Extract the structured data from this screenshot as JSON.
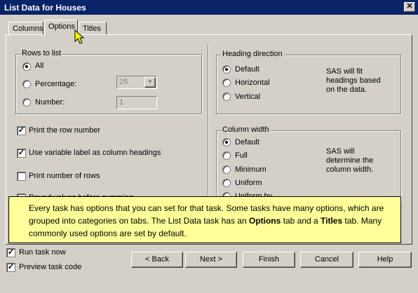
{
  "window": {
    "title": "List Data for Houses"
  },
  "tabs": [
    {
      "label": "Columns"
    },
    {
      "label": "Options"
    },
    {
      "label": "Titles"
    }
  ],
  "rows_to_list": {
    "legend": "Rows to list",
    "all_label": "All",
    "percentage_label": "Percentage:",
    "percentage_value": "25",
    "number_label": "Number:",
    "number_value": "1"
  },
  "checkboxes": [
    {
      "label": "Print the row number",
      "checked": true
    },
    {
      "label": "Use variable label as column headings",
      "checked": true
    },
    {
      "label": "Print number of rows",
      "checked": false
    },
    {
      "label": "Round values before summing",
      "checked": false
    }
  ],
  "heading_direction": {
    "legend": "Heading direction",
    "options": [
      "Default",
      "Horizontal",
      "Vertical"
    ],
    "selected": "Default",
    "note": "SAS will fit headings based on the data."
  },
  "column_width": {
    "legend": "Column width",
    "options": [
      "Default",
      "Full",
      "Minimum",
      "Uniform",
      "Uniform by"
    ],
    "selected": "Default",
    "note": "SAS will determine the column width."
  },
  "callout": {
    "text_1": "Every task has options that you can set for that task.  Some tasks have many options, which are grouped into categories on tabs.  The List Data task has an ",
    "bold_1": "Options",
    "text_2": " tab and a ",
    "bold_2": "Titles",
    "text_3": " tab.  Many commonly used options are set by default."
  },
  "footer": {
    "run_task_now": "Run task now",
    "preview_task_code": "Preview task code",
    "buttons": [
      "< Back",
      "Next >",
      "Finish",
      "Cancel",
      "Help"
    ]
  }
}
